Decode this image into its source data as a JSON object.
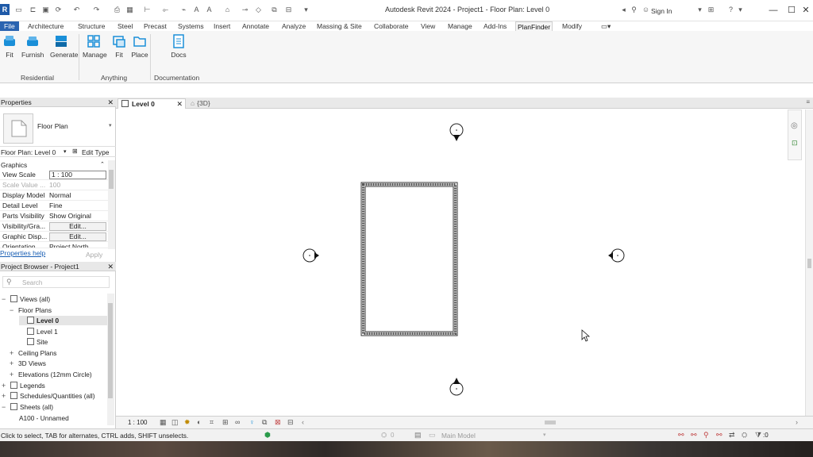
{
  "window": {
    "title": "Autodesk Revit 2024 - Project1 - Floor Plan: Level 0",
    "signin": "Sign In",
    "app_letter": "R"
  },
  "menu": {
    "file": "File",
    "tabs": [
      "Architecture",
      "Structure",
      "Steel",
      "Precast",
      "Systems",
      "Insert",
      "Annotate",
      "Analyze",
      "Massing & Site",
      "Collaborate",
      "View",
      "Manage",
      "Add-Ins",
      "PlanFinder",
      "Modify"
    ],
    "active": "PlanFinder"
  },
  "ribbon": {
    "buttons": [
      {
        "label": "Fit",
        "icon": "fit-furniture-icon"
      },
      {
        "label": "Furnish",
        "icon": "furnish-icon"
      },
      {
        "label": "Generate",
        "icon": "generate-icon"
      },
      {
        "label": "Manage",
        "icon": "manage-grid-icon"
      },
      {
        "label": "Fit",
        "icon": "fit-anything-icon"
      },
      {
        "label": "Place",
        "icon": "place-folder-icon"
      },
      {
        "label": "Docs",
        "icon": "docs-icon"
      }
    ],
    "panels": [
      "Residential",
      "Anything",
      "Documentation"
    ],
    "accent": "#1a8fd8"
  },
  "properties": {
    "title": "Properties",
    "type_name": "Floor Plan",
    "selector": "Floor Plan: Level 0",
    "edit_type": "Edit Type",
    "section": "Graphics",
    "rows": [
      {
        "key": "View Scale",
        "value": "1 : 100"
      },
      {
        "key": "Scale Value ...",
        "value": "100"
      },
      {
        "key": "Display Model",
        "value": "Normal"
      },
      {
        "key": "Detail Level",
        "value": "Fine"
      },
      {
        "key": "Parts Visibility",
        "value": "Show Original"
      },
      {
        "key": "Visibility/Gra...",
        "value": "Edit..."
      },
      {
        "key": "Graphic Disp...",
        "value": "Edit..."
      },
      {
        "key": "Orientation",
        "value": "Project North"
      }
    ],
    "help_link": "Properties help",
    "apply": "Apply"
  },
  "browser": {
    "title": "Project Browser - Project1",
    "search_placeholder": "Search",
    "items": [
      {
        "label": "Views (all)",
        "toggle": "−"
      },
      {
        "label": "Floor Plans",
        "toggle": "−"
      },
      {
        "label": "Level 0",
        "toggle": ""
      },
      {
        "label": "Level 1",
        "toggle": ""
      },
      {
        "label": "Site",
        "toggle": ""
      },
      {
        "label": "Ceiling Plans",
        "toggle": "+"
      },
      {
        "label": "3D Views",
        "toggle": "+"
      },
      {
        "label": "Elevations (12mm Circle)",
        "toggle": "+"
      },
      {
        "label": "Legends",
        "toggle": "+"
      },
      {
        "label": "Schedules/Quantities (all)",
        "toggle": "+"
      },
      {
        "label": "Sheets (all)",
        "toggle": "−"
      },
      {
        "label": "A100 - Unnamed",
        "toggle": ""
      }
    ]
  },
  "doc_tabs": [
    {
      "label": "Level 0"
    },
    {
      "label": "{3D}"
    }
  ],
  "viewbar": {
    "scale": "1 : 100"
  },
  "status": {
    "hint": "Click to select, TAB for alternates, CTRL adds, SHIFT unselects.",
    "worksets": "0",
    "model": "Main Model",
    "filter_count": ":0"
  }
}
